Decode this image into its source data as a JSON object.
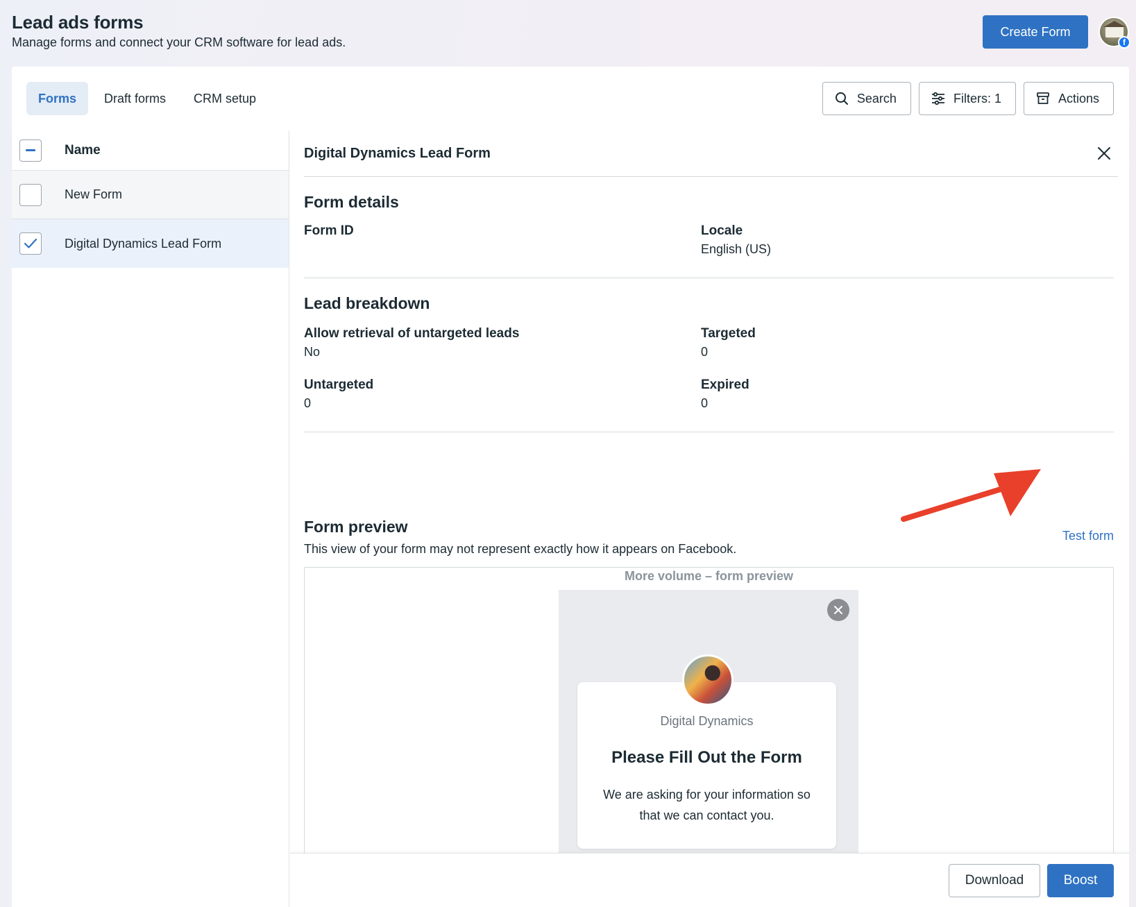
{
  "page": {
    "title": "Lead ads forms",
    "subtitle": "Manage forms and connect your CRM software for lead ads.",
    "create_button": "Create Form"
  },
  "tabs": [
    {
      "label": "Forms",
      "active": true
    },
    {
      "label": "Draft forms",
      "active": false
    },
    {
      "label": "CRM setup",
      "active": false
    }
  ],
  "toolbar": {
    "search_label": "Search",
    "filters_label": "Filters: 1",
    "actions_label": "Actions"
  },
  "list": {
    "header": "Name",
    "rows": [
      {
        "name": "New Form",
        "checked": false
      },
      {
        "name": "Digital Dynamics Lead Form",
        "checked": true
      }
    ]
  },
  "detail": {
    "title": "Digital Dynamics Lead Form",
    "form_details": {
      "heading": "Form details",
      "form_id_label": "Form ID",
      "locale_label": "Locale",
      "locale_value": "English (US)"
    },
    "lead_breakdown": {
      "heading": "Lead breakdown",
      "untargeted_retrieval_label": "Allow retrieval of untargeted leads",
      "untargeted_retrieval_value": "No",
      "targeted_label": "Targeted",
      "targeted_value": "0",
      "untargeted_label": "Untargeted",
      "untargeted_value": "0",
      "expired_label": "Expired",
      "expired_value": "0"
    },
    "form_preview": {
      "heading": "Form preview",
      "subtitle": "This view of your form may not represent exactly how it appears on Facebook.",
      "test_link": "Test form",
      "caption": "More volume – form preview",
      "page_name": "Digital Dynamics",
      "headline": "Please Fill Out the Form",
      "description": "We are asking for your information so that we can contact you."
    },
    "footer": {
      "download_label": "Download",
      "boost_label": "Boost"
    }
  },
  "colors": {
    "accent": "#2f72c3",
    "annotation_arrow": "#e8402b"
  }
}
